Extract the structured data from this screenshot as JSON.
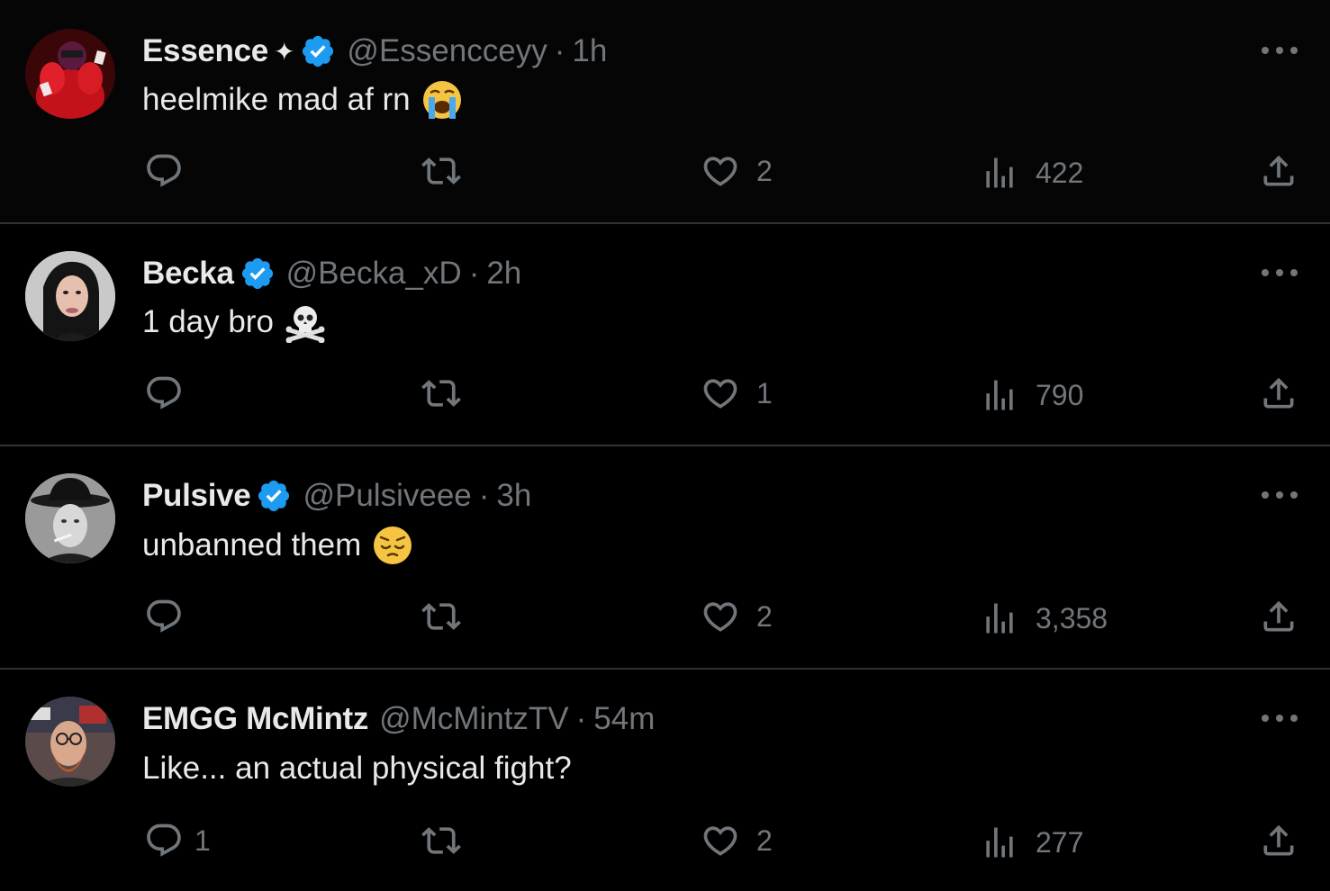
{
  "colors": {
    "background": "#000000",
    "text": "#e7e9ea",
    "secondary": "#71767b",
    "verified": "#1d9bf0",
    "divider": "#2f3336"
  },
  "tweets": [
    {
      "name": "Essence",
      "sparkle": "✦",
      "handle": "@Essencceyy",
      "separator": "·",
      "time": "1h",
      "text": "heelmike mad af rn",
      "emoji": "loudly-crying-face",
      "replies": "",
      "likes": "2",
      "views": "422"
    },
    {
      "name": "Becka",
      "handle": "@Becka_xD",
      "separator": "·",
      "time": "2h",
      "text": "1 day bro",
      "emoji": "skull-and-crossbones",
      "replies": "",
      "likes": "1",
      "views": "790"
    },
    {
      "name": "Pulsive",
      "handle": "@Pulsiveee",
      "separator": "·",
      "time": "3h",
      "text": "unbanned them",
      "emoji": "pensive-face",
      "replies": "",
      "likes": "2",
      "views": "3,358"
    },
    {
      "name": "EMGG McMintz",
      "handle": "@McMintzTV",
      "separator": "·",
      "time": "54m",
      "text": "Like... an actual physical fight?",
      "replies": "1",
      "likes": "2",
      "views": "277"
    }
  ],
  "icons": {
    "reply": "reply-icon",
    "retweet": "retweet-icon",
    "like": "heart-icon",
    "views": "views-icon",
    "share": "share-icon",
    "more": "more-icon",
    "verified": "verified-badge-icon"
  }
}
